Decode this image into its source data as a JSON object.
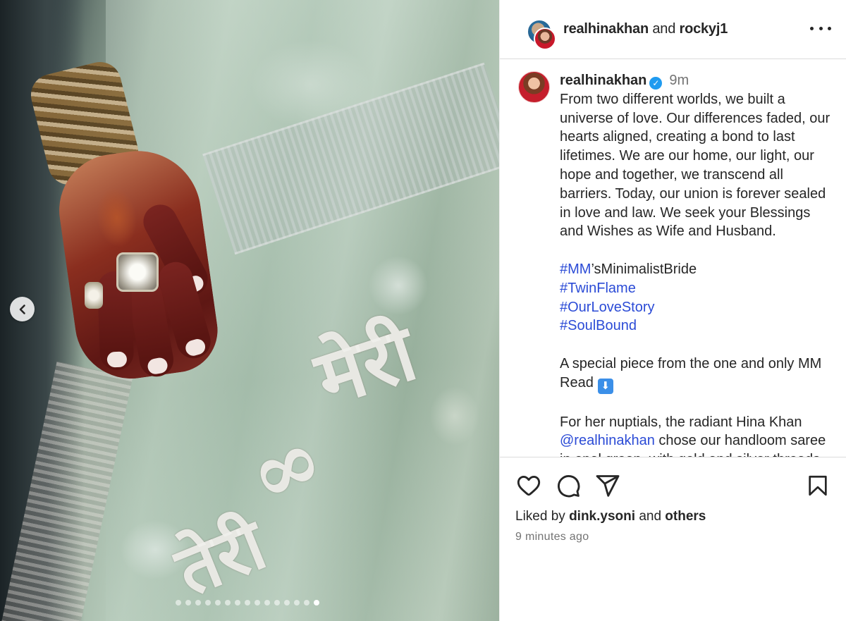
{
  "header": {
    "user1": "realhinakhan",
    "joiner": "and",
    "user2": "rockyj1",
    "more_icon": "more-horizontal-icon"
  },
  "caption": {
    "username": "realhinakhan",
    "verified_icon": "verified-badge-icon",
    "time": "9m",
    "paragraph1": "From two different worlds, we built a universe of love. Our differences faded, our hearts aligned, creating a bond to last lifetimes. We are our home, our light, our hope and together, we transcend all barriers. Today, our union is forever sealed in love and law. We seek your Blessings and Wishes as Wife and Husband.",
    "hashtags": [
      {
        "tag": "#MM",
        "tail": "’sMinimalistBride"
      },
      {
        "tag": "#TwinFlame",
        "tail": ""
      },
      {
        "tag": "#OurLoveStory",
        "tail": ""
      },
      {
        "tag": "#SoulBound",
        "tail": ""
      }
    ],
    "paragraph2": "A special piece from the one and only MM Read",
    "paragraph2_emoji": "⬇",
    "paragraph3_start": "For her nuptials, the radiant Hina Khan",
    "mention": "@realhinakhan",
    "paragraph3_rest": " chose our handloom saree in opal green, with gold and silver threads"
  },
  "media": {
    "alt": "Bride's hennaed hand resting on an opal green handloom saree with silver embroidery",
    "embroidery": [
      "मेरी",
      "∞",
      "तेरी"
    ],
    "carousel_prev_icon": "chevron-left-icon",
    "dots_total": 15,
    "active_dot": 14
  },
  "actions": {
    "like_icon": "heart-icon",
    "comment_icon": "comment-icon",
    "share_icon": "share-icon",
    "save_icon": "bookmark-icon",
    "liked_by_prefix": "Liked by",
    "liked_by_user": "dink.ysoni",
    "liked_by_joiner": "and",
    "liked_by_others": "others",
    "timestamp": "9 minutes ago"
  },
  "colors": {
    "link": "#2b4bd6",
    "verified": "#1f9bf0",
    "muted": "#737373",
    "text": "#262626"
  }
}
